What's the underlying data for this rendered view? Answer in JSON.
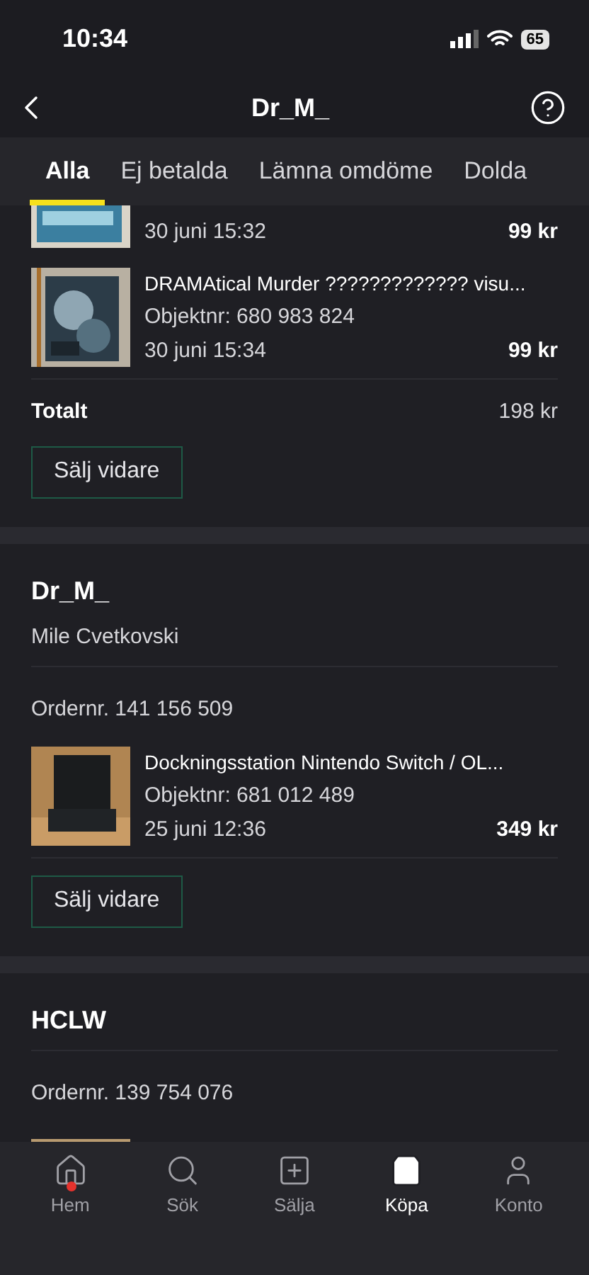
{
  "status_bar": {
    "time": "10:34",
    "battery": "65"
  },
  "header": {
    "title": "Dr_M_"
  },
  "tabs": [
    {
      "label": "Alla",
      "selected": true
    },
    {
      "label": "Ej betalda",
      "selected": false
    },
    {
      "label": "Lämna omdöme",
      "selected": false
    },
    {
      "label": "Dolda",
      "selected": false
    }
  ],
  "orders": [
    {
      "items": [
        {
          "kind": "cut",
          "date": "30 juni 15:32",
          "price": "99 kr"
        },
        {
          "kind": "product",
          "title": "DRAMAtical Murder ????????????? visu...",
          "object_no": "Objektnr: 680 983 824",
          "date": "30 juni 15:34",
          "price": "99 kr"
        }
      ],
      "total_label": "Totalt",
      "total": "198 kr",
      "button": "Sälj vidare"
    },
    {
      "seller": "Dr_M_",
      "name": "Mile Cvetkovski",
      "order_no": "Ordernr. 141 156 509",
      "items": [
        {
          "kind": "product",
          "title": "Dockningsstation Nintendo Switch / OL...",
          "object_no": "Objektnr: 681 012 489",
          "date": "25 juni 12:36",
          "price": "349 kr"
        }
      ],
      "button": "Sälj vidare"
    },
    {
      "seller": "HCLW",
      "order_no": "Ordernr. 139 754 076"
    }
  ],
  "nav": [
    {
      "label": "Hem",
      "selected": false,
      "badge": true
    },
    {
      "label": "Sök",
      "selected": false,
      "badge": false
    },
    {
      "label": "Sälja",
      "selected": false,
      "badge": false
    },
    {
      "label": "Köpa",
      "selected": true,
      "badge": false
    },
    {
      "label": "Konto",
      "selected": false,
      "badge": false
    }
  ]
}
